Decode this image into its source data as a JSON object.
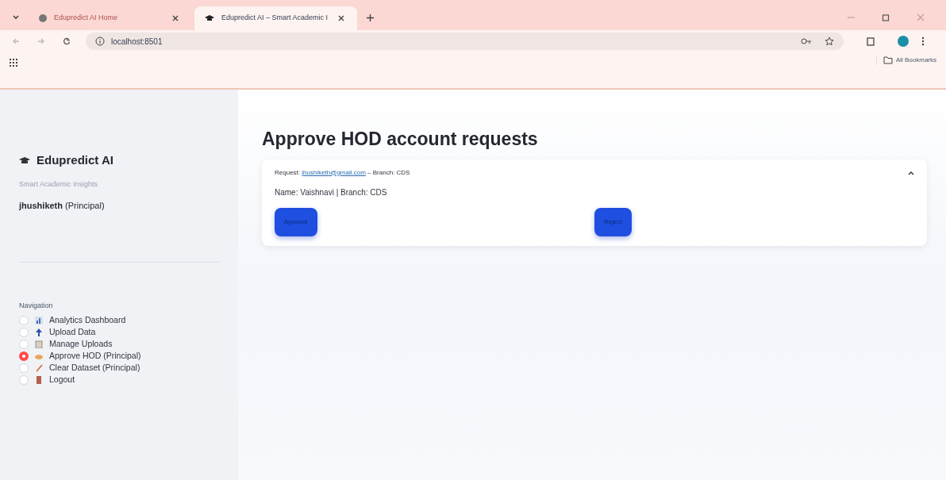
{
  "browser": {
    "tabs": [
      {
        "title": "Edupredict AI Home",
        "selected": false
      },
      {
        "title": "Edupredict AI – Smart Academic I",
        "selected": true
      }
    ],
    "url": "localhost:8501",
    "bookmarks_label": "All Bookmarks"
  },
  "sidebar": {
    "app_title": "Edupredict AI",
    "tagline": "Smart Academic Insights",
    "user": {
      "name": "jhushiketh",
      "role": "(Principal)"
    },
    "nav_label": "Navigation",
    "items": [
      {
        "label": "Analytics Dashboard",
        "selected": false
      },
      {
        "label": "Upload Data",
        "selected": false
      },
      {
        "label": "Manage Uploads",
        "selected": false
      },
      {
        "label": "Approve HOD (Principal)",
        "selected": true
      },
      {
        "label": "Clear Dataset (Principal)",
        "selected": false
      },
      {
        "label": "Logout",
        "selected": false
      }
    ]
  },
  "main": {
    "title": "Approve HOD account requests",
    "requests": [
      {
        "label": "Request:",
        "email": "jhushiketh@gmail.com",
        "branch_text": "– Branch: CDS",
        "expanded": true,
        "details": "Name: Vaishnavi | Branch: CDS",
        "buttons": [
          "Approve",
          "Reject"
        ]
      }
    ]
  }
}
